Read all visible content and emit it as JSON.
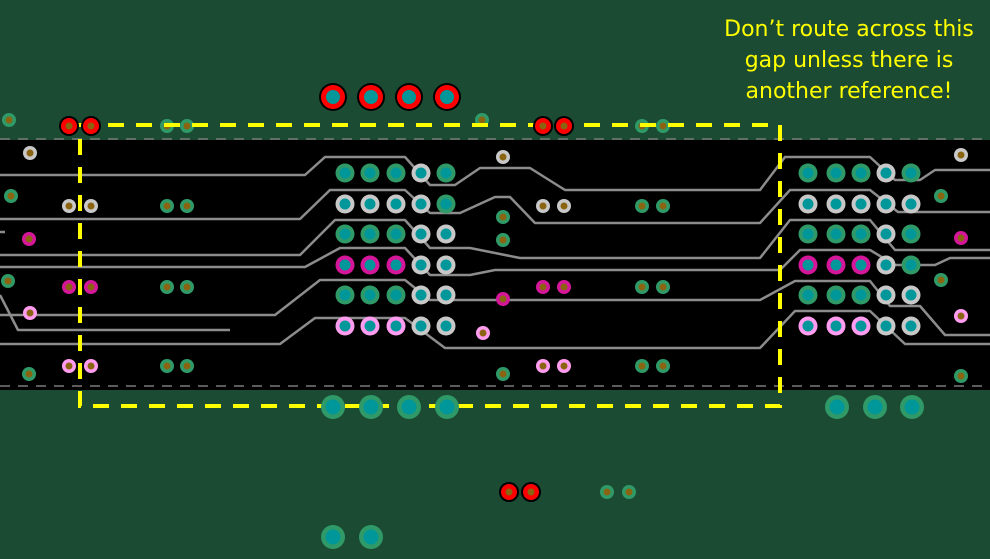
{
  "annotation": {
    "lines": [
      "Don’t route across this",
      "gap unless there is",
      "another reference!"
    ]
  },
  "colors": {
    "plane": "#1c4b33",
    "gap": "#000000",
    "trace": "#8c8c8c",
    "keepout_box": "#ffff00",
    "annotation_text": "#ffff00",
    "pad_green": "#2f9a68",
    "pad_gray": "#c8c8c8",
    "pad_magenta": "#d6169a",
    "pad_pink": "#ff9cf0",
    "pad_red": "#ff0000",
    "drill_teal": "#00979a",
    "drill_brown": "#8a6410"
  },
  "legend_semantics": {
    "dashed_yellow_box": "plane gap region",
    "black_band": "split / gap in reference plane",
    "gray_lines": "routed traces"
  }
}
